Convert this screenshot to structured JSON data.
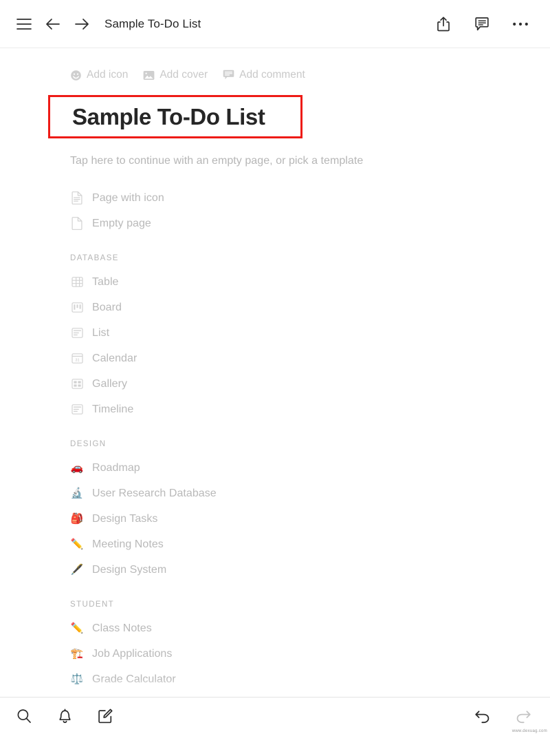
{
  "topbar": {
    "menu_icon": "hamburger-menu-icon",
    "back_icon": "arrow-left-icon",
    "forward_icon": "arrow-right-icon",
    "title": "Sample To-Do List",
    "share_icon": "share-icon",
    "comment_icon": "comment-icon",
    "more_icon": "ellipsis-icon"
  },
  "page_meta": {
    "add_icon": "Add icon",
    "add_cover": "Add cover",
    "add_comment": "Add comment"
  },
  "page": {
    "title": "Sample To-Do List",
    "title_highlight_color": "#ee1b16",
    "hint": "Tap here to continue with an empty page, or pick a template"
  },
  "templates": [
    {
      "section": "",
      "items": [
        {
          "label": "Page with icon",
          "icon": "page-with-lines-icon",
          "icon_type": "glyph"
        },
        {
          "label": "Empty page",
          "icon": "blank-page-icon",
          "icon_type": "glyph"
        }
      ]
    },
    {
      "section": "DATABASE",
      "items": [
        {
          "label": "Table",
          "icon": "table-icon",
          "icon_type": "glyph"
        },
        {
          "label": "Board",
          "icon": "board-icon",
          "icon_type": "glyph"
        },
        {
          "label": "List",
          "icon": "list-icon",
          "icon_type": "glyph"
        },
        {
          "label": "Calendar",
          "icon": "calendar-icon",
          "icon_type": "glyph"
        },
        {
          "label": "Gallery",
          "icon": "gallery-icon",
          "icon_type": "glyph"
        },
        {
          "label": "Timeline",
          "icon": "timeline-icon",
          "icon_type": "glyph"
        }
      ]
    },
    {
      "section": "DESIGN",
      "items": [
        {
          "label": "Roadmap",
          "icon": "car-emoji",
          "icon_type": "emoji",
          "emoji": "🚗"
        },
        {
          "label": "User Research Database",
          "icon": "microscope-emoji",
          "icon_type": "emoji",
          "emoji": "🔬"
        },
        {
          "label": "Design Tasks",
          "icon": "backpack-emoji",
          "icon_type": "emoji",
          "emoji": "🎒"
        },
        {
          "label": "Meeting Notes",
          "icon": "pencil-emoji",
          "icon_type": "emoji",
          "emoji": "✏️"
        },
        {
          "label": "Design System",
          "icon": "pen-emoji",
          "icon_type": "emoji",
          "emoji": "🖋️"
        }
      ]
    },
    {
      "section": "STUDENT",
      "items": [
        {
          "label": "Class Notes",
          "icon": "pencil-emoji",
          "icon_type": "emoji",
          "emoji": "✏️"
        },
        {
          "label": "Job Applications",
          "icon": "construction-crane-emoji",
          "icon_type": "emoji",
          "emoji": "🏗️"
        },
        {
          "label": "Grade Calculator",
          "icon": "balance-scale-emoji",
          "icon_type": "emoji",
          "emoji": "⚖️"
        }
      ]
    }
  ],
  "bottombar": {
    "search_icon": "search-icon",
    "notifications_icon": "bell-icon",
    "new_note_icon": "compose-icon",
    "undo_icon": "undo-arrow-icon",
    "redo_icon": "redo-arrow-icon",
    "watermark": "www.dexuag.com"
  }
}
